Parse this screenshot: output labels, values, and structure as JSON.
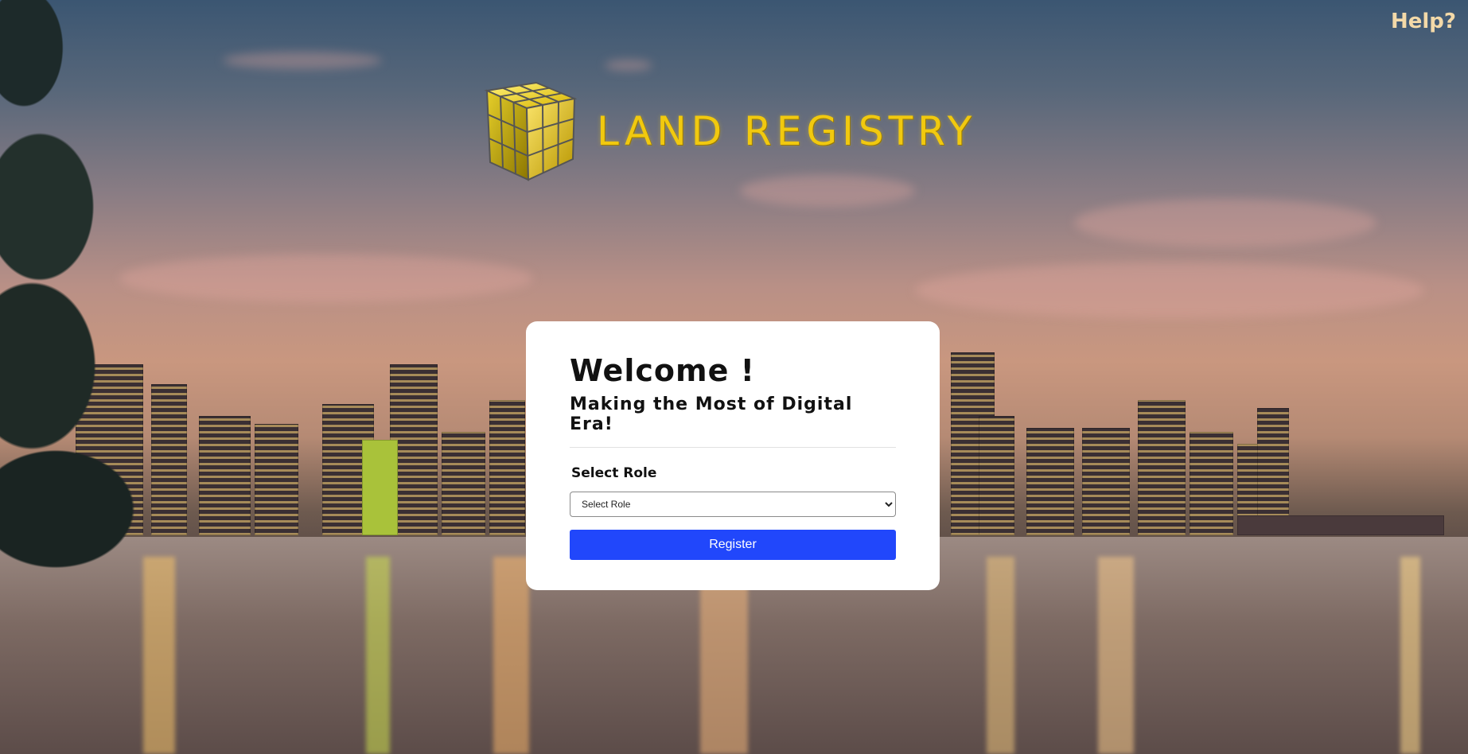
{
  "header": {
    "help_link": "Help?"
  },
  "logo": {
    "title": "LAND REGISTRY",
    "icon": "cube-logo-icon"
  },
  "card": {
    "heading": "Welcome !",
    "subheading": "Making the Most of Digital Era!",
    "role_label": "Select Role",
    "role_select": {
      "selected": "Select Role",
      "options": [
        "Select Role"
      ]
    },
    "register_label": "Register"
  },
  "colors": {
    "register_button": "#2147fb",
    "logo_text": "#f1c90f",
    "help_text": "#f3d9a8",
    "card_background": "#ffffff"
  }
}
